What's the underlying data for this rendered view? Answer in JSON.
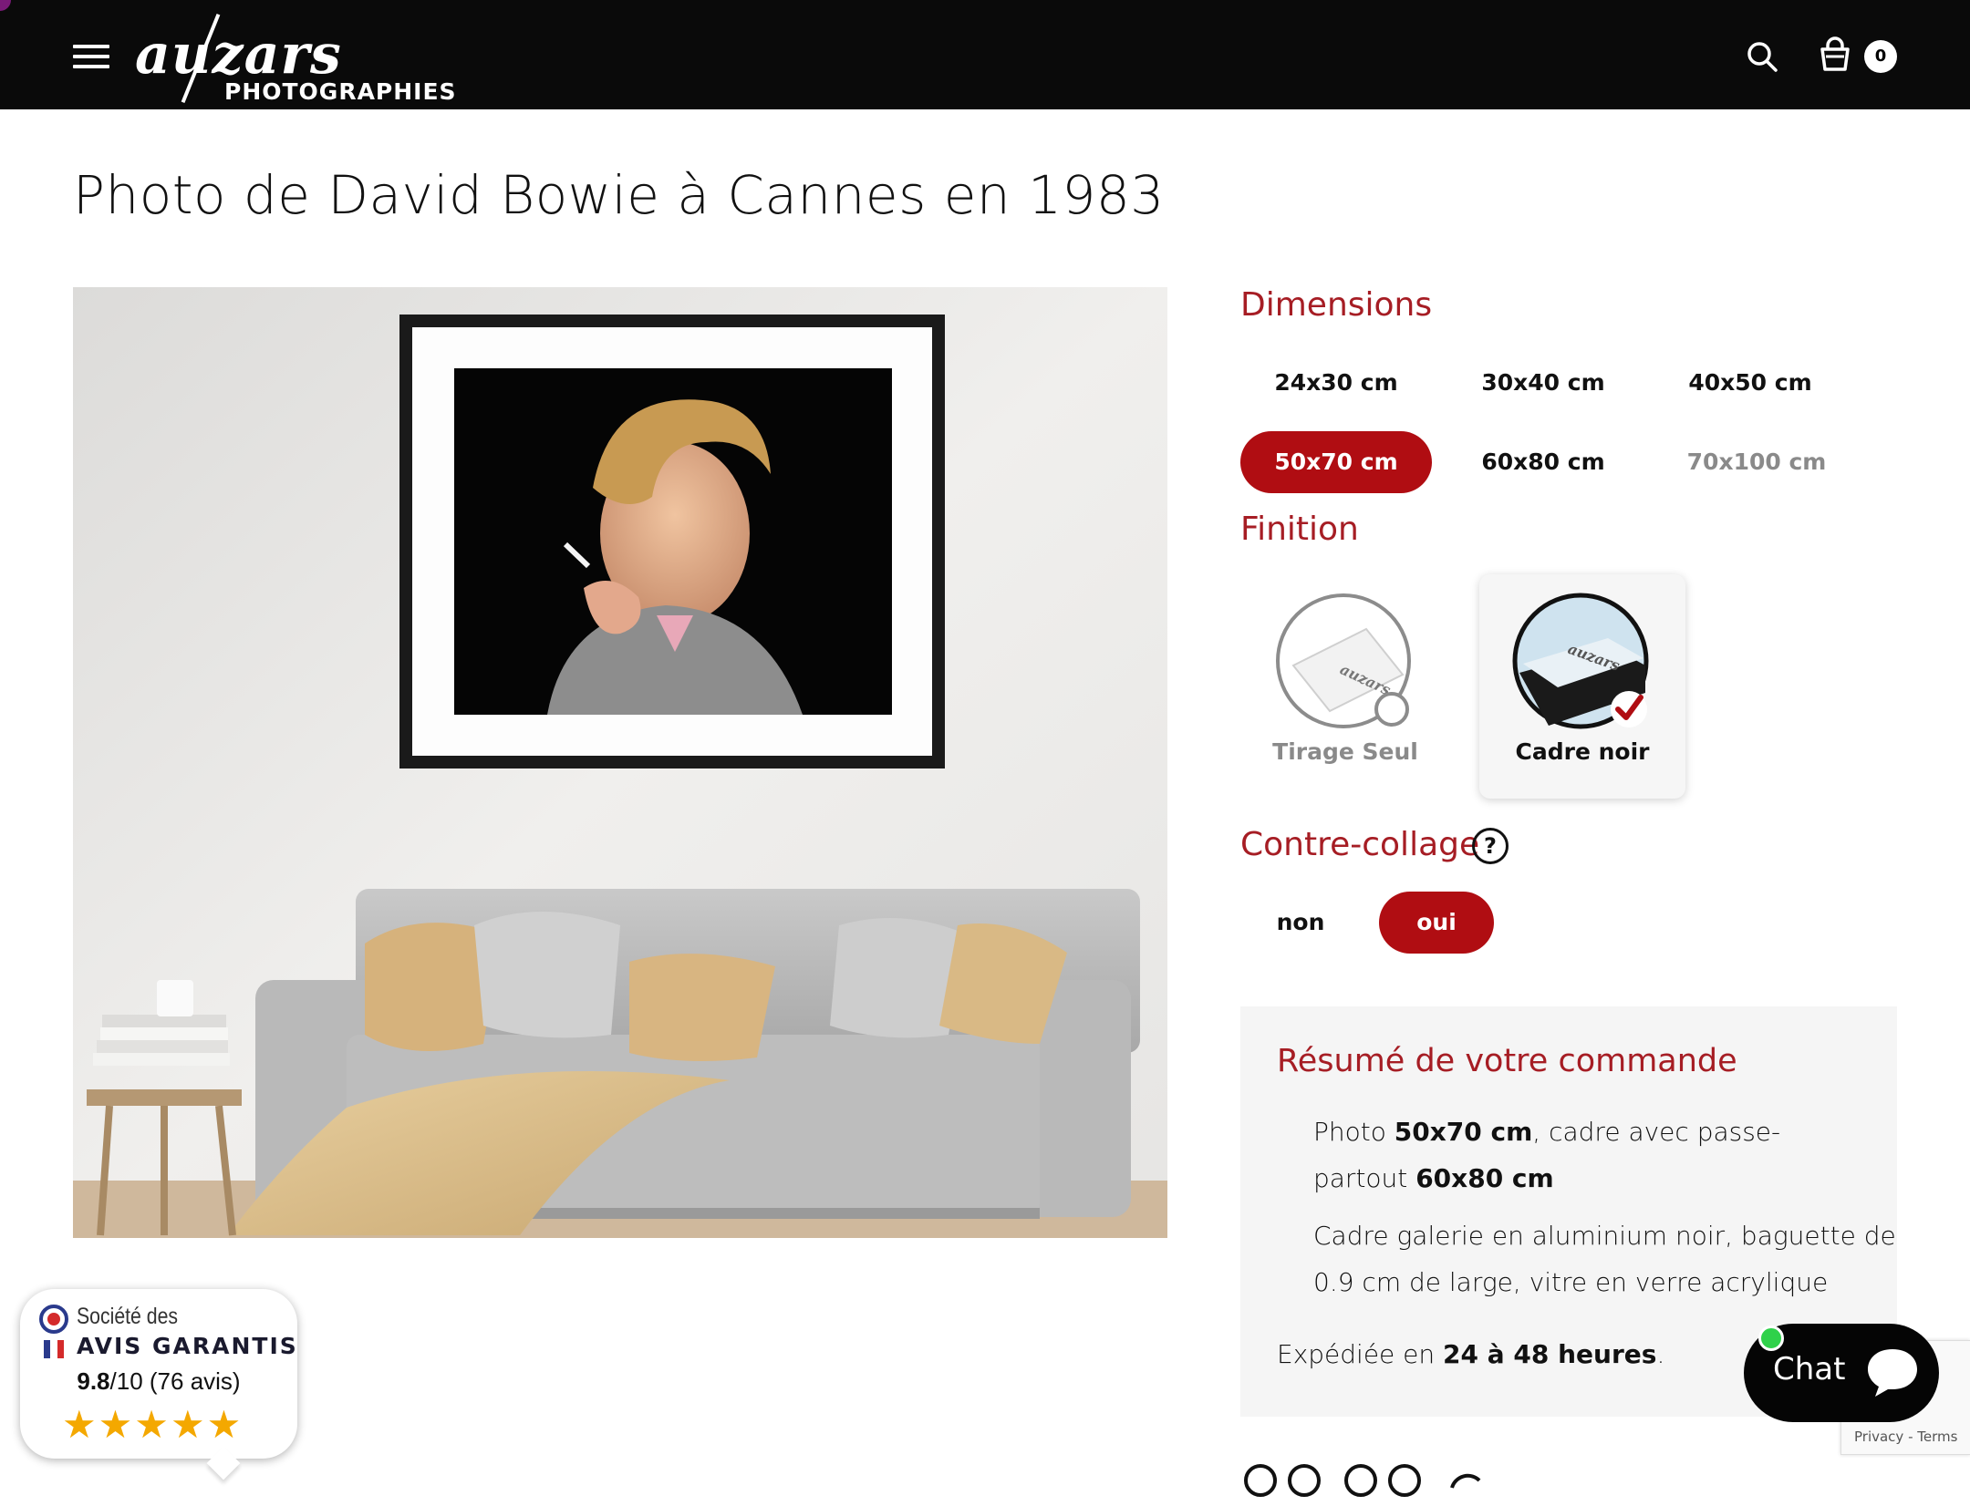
{
  "header": {
    "menu_icon": "hamburger-menu-icon",
    "logo_word": "auzars",
    "logo_sub": "PHOTOGRAPHIES",
    "search_icon": "search-icon",
    "cart_icon": "shopping-basket-icon",
    "cart_count": "0"
  },
  "page_title": "Photo de David Bowie à Cannes en 1983",
  "options": {
    "dimensions": {
      "title": "Dimensions",
      "items": [
        {
          "label": "24x30 cm",
          "state": "normal"
        },
        {
          "label": "30x40 cm",
          "state": "normal"
        },
        {
          "label": "40x50 cm",
          "state": "normal"
        },
        {
          "label": "50x70 cm",
          "state": "selected"
        },
        {
          "label": "60x80 cm",
          "state": "normal"
        },
        {
          "label": "70x100 cm",
          "state": "disabled"
        }
      ]
    },
    "finition": {
      "title": "Finition",
      "items": [
        {
          "label": "Tirage Seul",
          "state": "normal"
        },
        {
          "label": "Cadre noir",
          "state": "selected"
        }
      ]
    },
    "contre_collage": {
      "title": "Contre-collage",
      "help_icon": "question-circle-icon",
      "help_glyph": "?",
      "items": [
        {
          "label": "non",
          "state": "normal"
        },
        {
          "label": "oui",
          "state": "selected"
        }
      ]
    }
  },
  "summary": {
    "title": "Résumé de votre commande",
    "line1_pre": "Photo ",
    "line1_size": "50x70 cm",
    "line1_post": ", cadre avec passe-",
    "line2_pre": "partout ",
    "line2_size": "60x80 cm",
    "line3": "Cadre galerie en aluminium noir, baguette de",
    "line4": "0.9 cm de large, vitre en verre acrylique",
    "ship_pre": "Expédiée en ",
    "ship_bold": "24 à 48 heures",
    "ship_post": "."
  },
  "chat": {
    "label": "Chat",
    "icon": "chat-bubble-icon"
  },
  "recaptcha": {
    "text": "Privacy - Terms"
  },
  "avis": {
    "line1": "Société des",
    "line2": "AVIS GARANTIS",
    "score": "9.8",
    "score_suffix": "/10 (76 avis)",
    "stars": "★★★★★",
    "rating_fraction": 0.98
  },
  "colors": {
    "accent": "#a61d24",
    "selected_bg": "#b00d12",
    "header_bg": "#0a0a0a",
    "summary_bg": "#f5f5f5"
  }
}
